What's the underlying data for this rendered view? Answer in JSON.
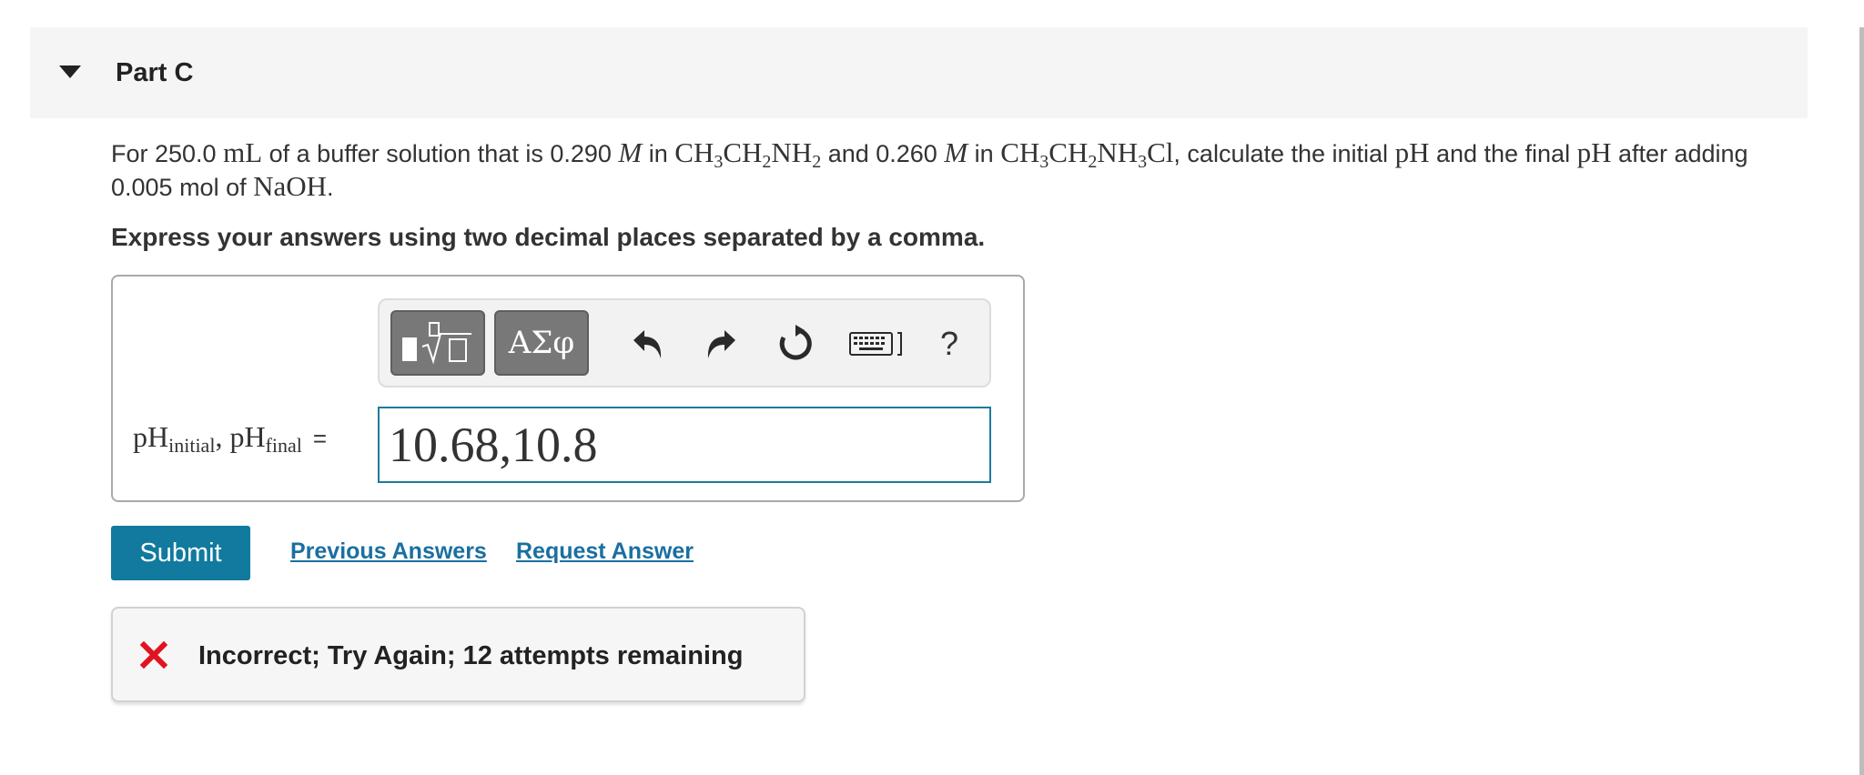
{
  "part": {
    "title": "Part C"
  },
  "question": {
    "t1": "For 250.0 ",
    "u1": "mL",
    "t2": " of a buffer solution that is 0.290 ",
    "m1": "M",
    "t3": " in ",
    "c1a": "CH",
    "c1b": "3",
    "c1c": "CH",
    "c1d": "2",
    "c1e": "NH",
    "c1f": "2",
    "t4": " and 0.260 ",
    "m2": "M",
    "t5": " in ",
    "c2a": "CH",
    "c2b": "3",
    "c2c": "CH",
    "c2d": "2",
    "c2e": "NH",
    "c2f": "3",
    "c2g": "Cl",
    "t6": ", calculate the initial ",
    "ph1": "pH",
    "t7": " and the final ",
    "ph2": "pH",
    "t8": " after adding 0.005 mol of ",
    "naoh": "NaOH",
    "t9": "."
  },
  "instruction": "Express your answers using two decimal places separated by a comma.",
  "toolbar": {
    "symbols_label": "ΑΣφ",
    "help_label": "?",
    "icons": [
      "templates-icon",
      "undo-icon",
      "redo-icon",
      "reset-icon",
      "keyboard-icon"
    ]
  },
  "answer": {
    "label_ph1": "pH",
    "label_sub1": "initial",
    "label_comma": ", ",
    "label_ph2": "pH",
    "label_sub2": "final",
    "label_eq": "=",
    "value": "10.68,10.8"
  },
  "actions": {
    "submit": "Submit",
    "previous_answers": "Previous Answers",
    "request_answer": "Request Answer"
  },
  "feedback": {
    "message": "Incorrect; Try Again; 12 attempts remaining",
    "status_color": "#e0141e"
  },
  "colors": {
    "accent": "#117a9e",
    "link": "#1a6fa0",
    "input_border": "#1f7a9b"
  }
}
